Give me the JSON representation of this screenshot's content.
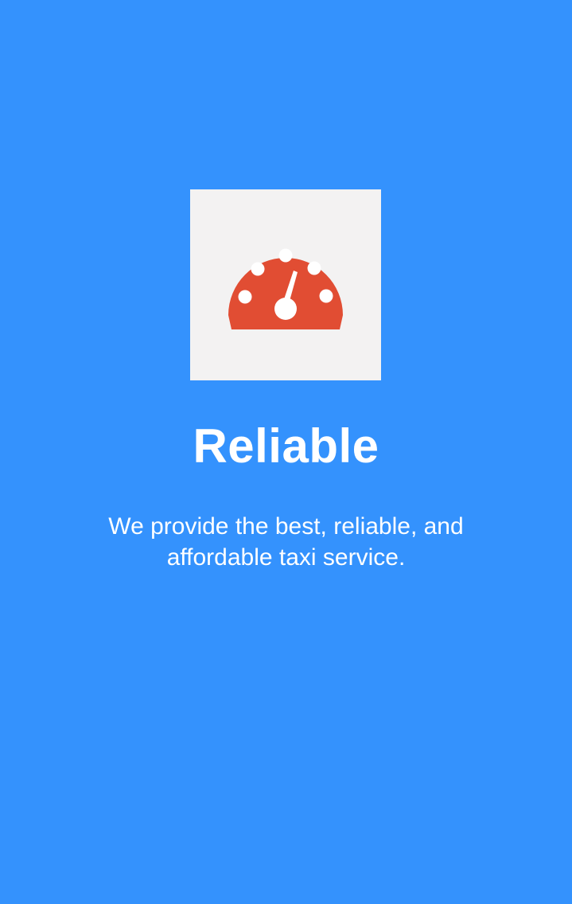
{
  "onboarding": {
    "icon": "speedometer-icon",
    "title": "Reliable",
    "description": "We provide the best, reliable, and affordable taxi service."
  },
  "colors": {
    "background": "#3492fd",
    "card": "#f3f2f2",
    "icon": "#e14d33",
    "text": "#ffffff"
  }
}
